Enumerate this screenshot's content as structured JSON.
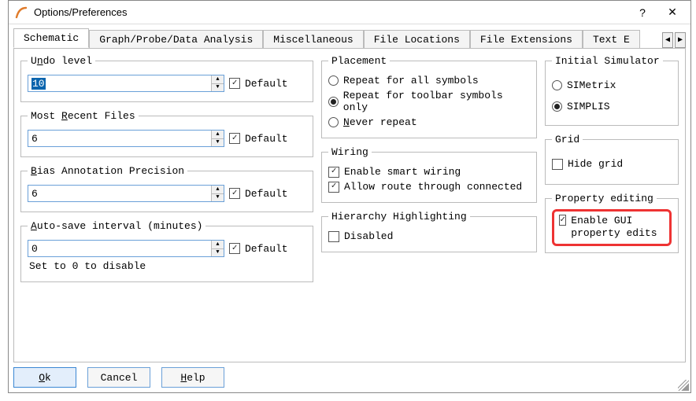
{
  "window": {
    "title": "Options/Preferences",
    "help_btn": "?",
    "close_btn": "✕"
  },
  "tabs": {
    "items": [
      {
        "label": "Schematic",
        "active": true
      },
      {
        "label": "Graph/Probe/Data Analysis"
      },
      {
        "label": "Miscellaneous"
      },
      {
        "label": "File Locations"
      },
      {
        "label": "File Extensions"
      },
      {
        "label": "Text E"
      }
    ]
  },
  "left": {
    "undo": {
      "legend_pre": "U",
      "legend_mid": "n",
      "legend_post": "do level",
      "value": "10",
      "default_label": "Default",
      "default_checked": true
    },
    "recent": {
      "legend_pre": "Most ",
      "legend_mid": "R",
      "legend_post": "ecent Files",
      "value": "6",
      "default_label": "Default",
      "default_checked": true
    },
    "bias": {
      "legend_pre": "",
      "legend_mid": "B",
      "legend_post": "ias Annotation Precision",
      "value": "6",
      "default_label": "Default",
      "default_checked": true
    },
    "autosave": {
      "legend_pre": "",
      "legend_mid": "A",
      "legend_post": "uto-save interval (minutes)",
      "value": "0",
      "default_label": "Default",
      "default_checked": true,
      "note": "Set to 0 to disable"
    }
  },
  "mid": {
    "placement": {
      "legend": "Placement",
      "opts": [
        {
          "label": "Repeat for all symbols",
          "checked": false
        },
        {
          "label": "Repeat for toolbar symbols only",
          "checked": true
        },
        {
          "label_pre": "",
          "label_mid": "N",
          "label_post": "ever repeat",
          "checked": false
        }
      ]
    },
    "wiring": {
      "legend": "Wiring",
      "opts": [
        {
          "label": "Enable smart wiring",
          "checked": true
        },
        {
          "label": "Allow route through connected",
          "checked": true
        }
      ]
    },
    "hierarchy": {
      "legend": "Hierarchy Highlighting",
      "label": "Disabled",
      "checked": false
    }
  },
  "right": {
    "sim": {
      "legend": "Initial Simulator",
      "opts": [
        {
          "label": "SIMetrix",
          "checked": false
        },
        {
          "label": "SIMPLIS",
          "checked": true
        }
      ]
    },
    "grid": {
      "legend": "Grid",
      "label": "Hide grid",
      "checked": false
    },
    "prop": {
      "legend": "Property editing",
      "label": "Enable GUI property edits",
      "checked": true
    }
  },
  "footer": {
    "ok_pre": "",
    "ok_mid": "O",
    "ok_post": "k",
    "cancel": "Cancel",
    "help_pre": "",
    "help_mid": "H",
    "help_post": "elp"
  }
}
